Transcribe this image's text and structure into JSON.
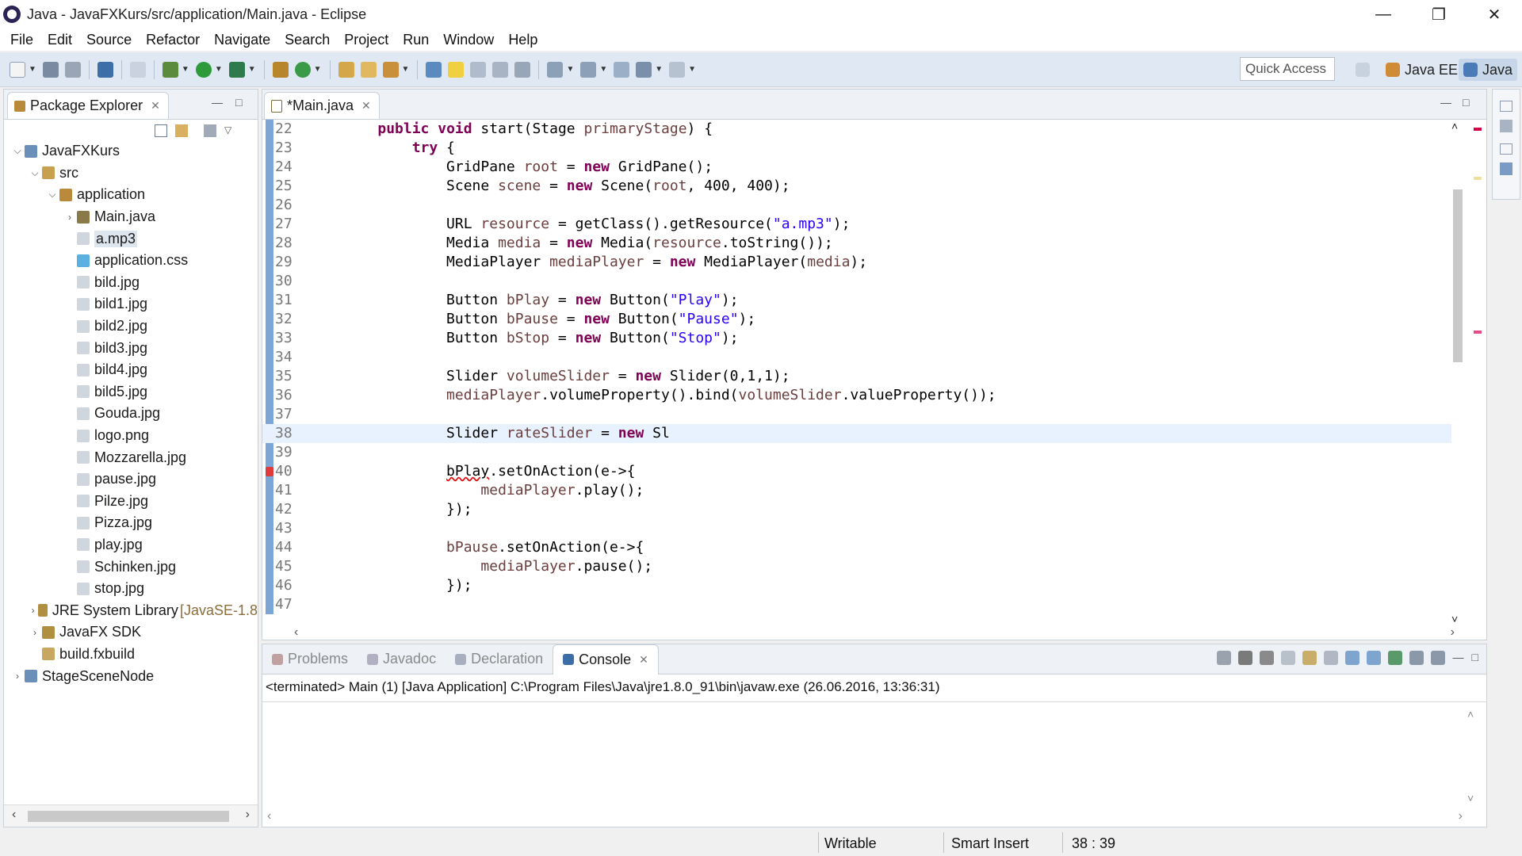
{
  "window": {
    "title": "Java - JavaFXKurs/src/application/Main.java - Eclipse",
    "minimize_label": "—",
    "maximize_label": "❐",
    "close_label": "✕"
  },
  "menu": [
    "File",
    "Edit",
    "Source",
    "Refactor",
    "Navigate",
    "Search",
    "Project",
    "Run",
    "Window",
    "Help"
  ],
  "toolbar": {
    "quick_access_placeholder": "Quick Access",
    "perspectives": [
      "Java EE",
      "Java"
    ]
  },
  "package_explorer": {
    "tab_label": "Package Explorer",
    "tree": [
      {
        "label": "JavaFXKurs",
        "depth": 0,
        "arrow": "expanded",
        "icon": "project-icon"
      },
      {
        "label": "src",
        "depth": 1,
        "arrow": "expanded",
        "icon": "source-folder-icon"
      },
      {
        "label": "application",
        "depth": 2,
        "arrow": "expanded",
        "icon": "package-icon"
      },
      {
        "label": "Main.java",
        "depth": 3,
        "arrow": "collapsed",
        "icon": "java-file-icon"
      },
      {
        "label": "a.mp3",
        "depth": 3,
        "arrow": "none",
        "icon": "file-icon",
        "selected": true
      },
      {
        "label": "application.css",
        "depth": 3,
        "arrow": "none",
        "icon": "css-file-icon"
      },
      {
        "label": "bild.jpg",
        "depth": 3,
        "arrow": "none",
        "icon": "file-icon"
      },
      {
        "label": "bild1.jpg",
        "depth": 3,
        "arrow": "none",
        "icon": "file-icon"
      },
      {
        "label": "bild2.jpg",
        "depth": 3,
        "arrow": "none",
        "icon": "file-icon"
      },
      {
        "label": "bild3.jpg",
        "depth": 3,
        "arrow": "none",
        "icon": "file-icon"
      },
      {
        "label": "bild4.jpg",
        "depth": 3,
        "arrow": "none",
        "icon": "file-icon"
      },
      {
        "label": "bild5.jpg",
        "depth": 3,
        "arrow": "none",
        "icon": "file-icon"
      },
      {
        "label": "Gouda.jpg",
        "depth": 3,
        "arrow": "none",
        "icon": "file-icon"
      },
      {
        "label": "logo.png",
        "depth": 3,
        "arrow": "none",
        "icon": "file-icon"
      },
      {
        "label": "Mozzarella.jpg",
        "depth": 3,
        "arrow": "none",
        "icon": "file-icon"
      },
      {
        "label": "pause.jpg",
        "depth": 3,
        "arrow": "none",
        "icon": "file-icon"
      },
      {
        "label": "Pilze.jpg",
        "depth": 3,
        "arrow": "none",
        "icon": "file-icon"
      },
      {
        "label": "Pizza.jpg",
        "depth": 3,
        "arrow": "none",
        "icon": "file-icon"
      },
      {
        "label": "play.jpg",
        "depth": 3,
        "arrow": "none",
        "icon": "file-icon"
      },
      {
        "label": "Schinken.jpg",
        "depth": 3,
        "arrow": "none",
        "icon": "file-icon"
      },
      {
        "label": "stop.jpg",
        "depth": 3,
        "arrow": "none",
        "icon": "file-icon"
      },
      {
        "label": "JRE System Library",
        "decoration": "[JavaSE-1.8",
        "depth": 1,
        "arrow": "collapsed",
        "icon": "library-icon"
      },
      {
        "label": "JavaFX SDK",
        "depth": 1,
        "arrow": "collapsed",
        "icon": "library-icon"
      },
      {
        "label": "build.fxbuild",
        "depth": 1,
        "arrow": "none",
        "icon": "build-file-icon"
      },
      {
        "label": "StageSceneNode",
        "depth": 0,
        "arrow": "collapsed",
        "icon": "project-icon"
      }
    ]
  },
  "editor": {
    "tab_label": "*Main.java",
    "lines": [
      {
        "n": "22",
        "code": [
          [
            "",
            "\t"
          ],
          [
            "kw",
            "public"
          ],
          [
            "",
            " "
          ],
          [
            "kw",
            "void"
          ],
          [
            "",
            " start(Stage "
          ],
          [
            "var",
            "primaryStage"
          ],
          [
            "",
            ") {"
          ]
        ]
      },
      {
        "n": "23",
        "code": [
          [
            "",
            "\t\t"
          ],
          [
            "kw",
            "try"
          ],
          [
            "",
            " {"
          ]
        ]
      },
      {
        "n": "24",
        "code": [
          [
            "",
            "\t\t\tGridPane "
          ],
          [
            "var",
            "root"
          ],
          [
            "",
            " = "
          ],
          [
            "kw",
            "new"
          ],
          [
            "",
            " GridPane();"
          ]
        ]
      },
      {
        "n": "25",
        "code": [
          [
            "",
            "\t\t\tScene "
          ],
          [
            "var",
            "scene"
          ],
          [
            "",
            " = "
          ],
          [
            "kw",
            "new"
          ],
          [
            "",
            " Scene("
          ],
          [
            "var",
            "root"
          ],
          [
            "",
            ", 400, 400);"
          ]
        ]
      },
      {
        "n": "26",
        "code": []
      },
      {
        "n": "27",
        "code": [
          [
            "",
            "\t\t\tURL "
          ],
          [
            "var",
            "resource"
          ],
          [
            "",
            " = getClass().getResource("
          ],
          [
            "str",
            "\"a.mp3\""
          ],
          [
            "",
            ");"
          ]
        ]
      },
      {
        "n": "28",
        "code": [
          [
            "",
            "\t\t\tMedia "
          ],
          [
            "var",
            "media"
          ],
          [
            "",
            " = "
          ],
          [
            "kw",
            "new"
          ],
          [
            "",
            " Media("
          ],
          [
            "var",
            "resource"
          ],
          [
            "",
            ".toString());"
          ]
        ]
      },
      {
        "n": "29",
        "code": [
          [
            "",
            "\t\t\tMediaPlayer "
          ],
          [
            "var",
            "mediaPlayer"
          ],
          [
            "",
            " = "
          ],
          [
            "kw",
            "new"
          ],
          [
            "",
            " MediaPlayer("
          ],
          [
            "var",
            "media"
          ],
          [
            "",
            ");"
          ]
        ]
      },
      {
        "n": "30",
        "code": []
      },
      {
        "n": "31",
        "code": [
          [
            "",
            "\t\t\tButton "
          ],
          [
            "var",
            "bPlay"
          ],
          [
            "",
            " = "
          ],
          [
            "kw",
            "new"
          ],
          [
            "",
            " Button("
          ],
          [
            "str",
            "\"Play\""
          ],
          [
            "",
            ");"
          ]
        ]
      },
      {
        "n": "32",
        "code": [
          [
            "",
            "\t\t\tButton "
          ],
          [
            "var",
            "bPause"
          ],
          [
            "",
            " = "
          ],
          [
            "kw",
            "new"
          ],
          [
            "",
            " Button("
          ],
          [
            "str",
            "\"Pause\""
          ],
          [
            "",
            ");"
          ]
        ]
      },
      {
        "n": "33",
        "code": [
          [
            "",
            "\t\t\tButton "
          ],
          [
            "var",
            "bStop"
          ],
          [
            "",
            " = "
          ],
          [
            "kw",
            "new"
          ],
          [
            "",
            " Button("
          ],
          [
            "str",
            "\"Stop\""
          ],
          [
            "",
            ");"
          ]
        ]
      },
      {
        "n": "34",
        "code": []
      },
      {
        "n": "35",
        "code": [
          [
            "",
            "\t\t\tSlider "
          ],
          [
            "var",
            "volumeSlider"
          ],
          [
            "",
            " = "
          ],
          [
            "kw",
            "new"
          ],
          [
            "",
            " Slider(0,1,1);"
          ]
        ]
      },
      {
        "n": "36",
        "code": [
          [
            "",
            "\t\t\t"
          ],
          [
            "var",
            "mediaPlayer"
          ],
          [
            "",
            ".volumeProperty().bind("
          ],
          [
            "var",
            "volumeSlider"
          ],
          [
            "",
            ".valueProperty());"
          ]
        ]
      },
      {
        "n": "37",
        "code": []
      },
      {
        "n": "38",
        "code": [
          [
            "",
            "\t\t\tSlider "
          ],
          [
            "var",
            "rateSlider"
          ],
          [
            "",
            " = "
          ],
          [
            "kw",
            "new"
          ],
          [
            "",
            " Sl"
          ]
        ],
        "current": true
      },
      {
        "n": "39",
        "code": []
      },
      {
        "n": "40",
        "code": [
          [
            "",
            "\t\t\t"
          ],
          [
            "err",
            "bPlay"
          ],
          [
            "",
            ".setOnAction(e->{"
          ]
        ],
        "error": true
      },
      {
        "n": "41",
        "code": [
          [
            "",
            "\t\t\t\t"
          ],
          [
            "var",
            "mediaPlayer"
          ],
          [
            "",
            ".play();"
          ]
        ]
      },
      {
        "n": "42",
        "code": [
          [
            "",
            "\t\t\t});"
          ]
        ]
      },
      {
        "n": "43",
        "code": []
      },
      {
        "n": "44",
        "code": [
          [
            "",
            "\t\t\t"
          ],
          [
            "var",
            "bPause"
          ],
          [
            "",
            ".setOnAction(e->{"
          ]
        ]
      },
      {
        "n": "45",
        "code": [
          [
            "",
            "\t\t\t\t"
          ],
          [
            "var",
            "mediaPlayer"
          ],
          [
            "",
            ".pause();"
          ]
        ]
      },
      {
        "n": "46",
        "code": [
          [
            "",
            "\t\t\t});"
          ]
        ]
      },
      {
        "n": "47",
        "code": []
      }
    ]
  },
  "bottom_panel": {
    "tabs": [
      {
        "label": "Problems",
        "active": false,
        "icon": "problems-icon"
      },
      {
        "label": "Javadoc",
        "active": false,
        "icon": "javadoc-icon"
      },
      {
        "label": "Declaration",
        "active": false,
        "icon": "declaration-icon"
      },
      {
        "label": "Console",
        "active": true,
        "icon": "console-icon"
      }
    ],
    "console_header": "<terminated> Main (1) [Java Application] C:\\Program Files\\Java\\jre1.8.0_91\\bin\\javaw.exe (26.06.2016, 13:36:31)"
  },
  "status": {
    "writable": "Writable",
    "insert_mode": "Smart Insert",
    "cursor_position": "38 : 39"
  },
  "colors": {
    "toolbar_bg": "#dfe8f3",
    "keyword": "#7f0055",
    "string": "#2a00ff",
    "variable": "#6a3e3e",
    "current_line": "#e8f2fe",
    "gutter_change_bar": "#7ba6d6"
  }
}
